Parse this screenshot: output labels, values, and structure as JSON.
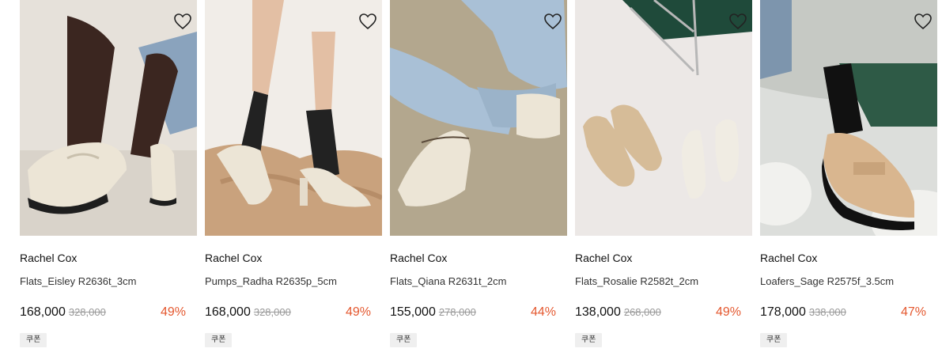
{
  "products": [
    {
      "brand": "Rachel Cox",
      "name": "Flats_Eisley R2636t_3cm",
      "price": "168,000",
      "original_price": "328,000",
      "discount": "49%",
      "badge": "쿠폰",
      "icon": "heart-icon"
    },
    {
      "brand": "Rachel Cox",
      "name": "Pumps_Radha R2635p_5cm",
      "price": "168,000",
      "original_price": "328,000",
      "discount": "49%",
      "badge": "쿠폰",
      "icon": "heart-icon"
    },
    {
      "brand": "Rachel Cox",
      "name": "Flats_Qiana R2631t_2cm",
      "price": "155,000",
      "original_price": "278,000",
      "discount": "44%",
      "badge": "쿠폰",
      "icon": "heart-icon"
    },
    {
      "brand": "Rachel Cox",
      "name": "Flats_Rosalie R2582t_2cm",
      "price": "138,000",
      "original_price": "268,000",
      "discount": "49%",
      "badge": "쿠폰",
      "icon": "heart-icon"
    },
    {
      "brand": "Rachel Cox",
      "name": "Loafers_Sage R2575f_3.5cm",
      "price": "178,000",
      "original_price": "338,000",
      "discount": "47%",
      "badge": "쿠폰",
      "icon": "heart-icon"
    }
  ],
  "colors": {
    "discount": "#e4582f",
    "badge_bg": "#efefef",
    "strikethrough": "#999999"
  }
}
